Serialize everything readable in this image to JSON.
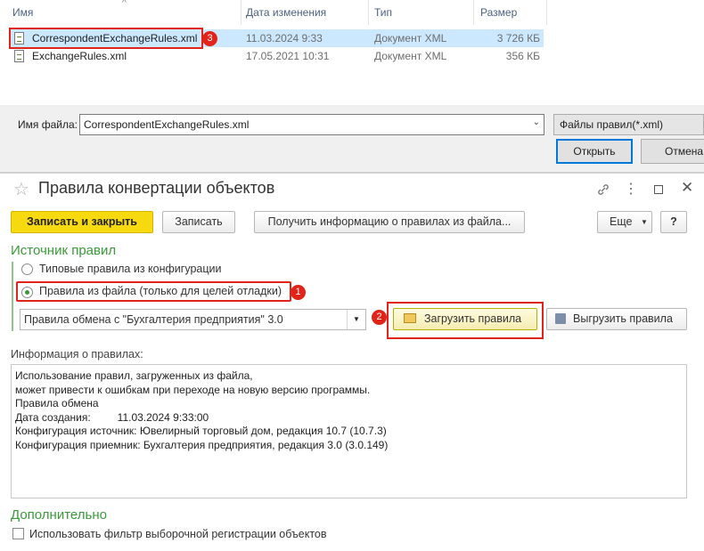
{
  "dialog": {
    "columns": {
      "name": "Имя",
      "date": "Дата изменения",
      "type": "Тип",
      "size": "Размер"
    },
    "files": [
      {
        "name": "CorrespondentExchangeRules.xml",
        "date": "11.03.2024 9:33",
        "type": "Документ XML",
        "size": "3 726 КБ",
        "selected": true
      },
      {
        "name": "ExchangeRules.xml",
        "date": "17.05.2021 10:31",
        "type": "Документ XML",
        "size": "356 КБ",
        "selected": false
      }
    ],
    "badge": "3",
    "filename_label": "Имя файла:",
    "filename_value": "CorrespondentExchangeRules.xml",
    "filter_value": "Файлы правил(*.xml)",
    "open_label": "Открыть",
    "cancel_label": "Отмена"
  },
  "form": {
    "title": "Правила конвертации объектов",
    "toolbar": {
      "save_close": "Записать и закрыть",
      "save": "Записать",
      "get_info": "Получить информацию о правилах из файла...",
      "more": "Еще",
      "help": "?"
    },
    "source_section": "Источник правил",
    "radio_config": "Типовые правила из конфигурации",
    "radio_file": "Правила из файла (только для целей отладки)",
    "badge1": "1",
    "rules_select": "Правила обмена с \"Бухгалтерия предприятия\" 3.0",
    "badge2": "2",
    "load_button": "Загрузить правила",
    "unload_button": "Выгрузить правила",
    "info_label": "Информация о правилах:",
    "info_lines": [
      "Использование правил, загруженных из файла,",
      "может привести к ошибкам при переходе на новую версию программы.",
      "",
      "Правила обмена",
      "Дата создания:         11.03.2024 9:33:00",
      "Конфигурация источник: Ювелирный торговый дом, редакция 10.7 (10.7.3)",
      "Конфигурация приемник: Бухгалтерия предприятия, редакция 3.0 (3.0.149)"
    ],
    "extra_section": "Дополнительно",
    "filter_checkbox": "Использовать фильтр выборочной регистрации объектов"
  },
  "colors": {
    "accent_yellow": "#f7d90f",
    "green": "#3a9a3a",
    "red": "#e2231a",
    "selected_row": "#cce8ff"
  }
}
